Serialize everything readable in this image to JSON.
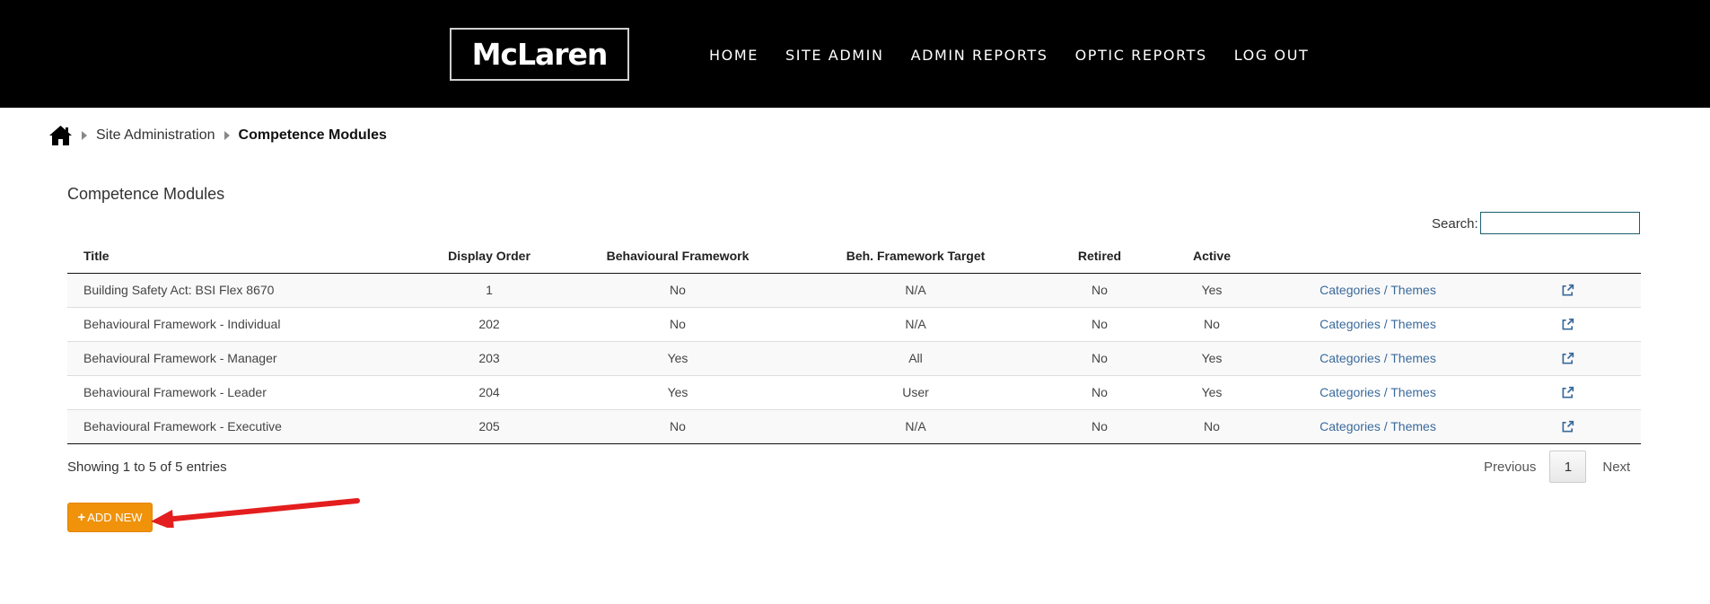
{
  "header": {
    "logo": "McLaren",
    "nav": [
      "HOME",
      "SITE ADMIN",
      "ADMIN REPORTS",
      "OPTIC REPORTS",
      "LOG OUT"
    ]
  },
  "breadcrumb": {
    "home_icon": "home-icon",
    "items": [
      "Site Administration",
      "Competence Modules"
    ]
  },
  "page": {
    "heading": "Competence Modules",
    "search_label": "Search:",
    "search_value": ""
  },
  "table": {
    "columns": [
      "Title",
      "Display Order",
      "Behavioural Framework",
      "Beh. Framework Target",
      "Retired",
      "Active",
      "",
      ""
    ],
    "rows": [
      {
        "title": "Building Safety Act: BSI Flex 8670",
        "order": "1",
        "bf": "No",
        "target": "N/A",
        "retired": "No",
        "active": "Yes",
        "link": "Categories / Themes"
      },
      {
        "title": "Behavioural Framework - Individual",
        "order": "202",
        "bf": "No",
        "target": "N/A",
        "retired": "No",
        "active": "No",
        "link": "Categories / Themes"
      },
      {
        "title": "Behavioural Framework - Manager",
        "order": "203",
        "bf": "Yes",
        "target": "All",
        "retired": "No",
        "active": "Yes",
        "link": "Categories / Themes"
      },
      {
        "title": "Behavioural Framework - Leader",
        "order": "204",
        "bf": "Yes",
        "target": "User",
        "retired": "No",
        "active": "Yes",
        "link": "Categories / Themes"
      },
      {
        "title": "Behavioural Framework - Executive",
        "order": "205",
        "bf": "No",
        "target": "N/A",
        "retired": "No",
        "active": "No",
        "link": "Categories / Themes"
      }
    ]
  },
  "footer": {
    "info": "Showing 1 to 5 of 5 entries",
    "previous": "Previous",
    "page": "1",
    "next": "Next",
    "add_new": "ADD NEW"
  },
  "colors": {
    "header_bg": "#000000",
    "accent_button": "#f0920a",
    "link": "#3a6a9c",
    "annotation_arrow": "#e41e1e"
  }
}
